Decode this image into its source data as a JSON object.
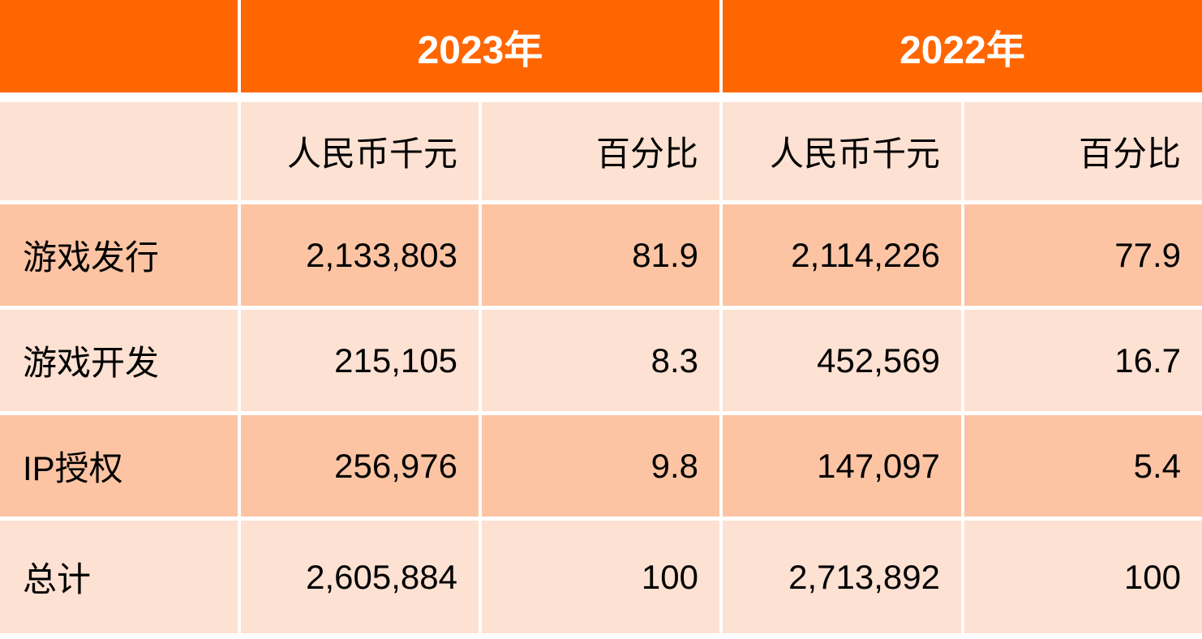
{
  "header": {
    "corner": "",
    "years": [
      "2023年",
      "2022年"
    ]
  },
  "subheader": {
    "corner": "",
    "columns": [
      "人民币千元",
      "百分比",
      "人民币千元",
      "百分比"
    ]
  },
  "rows": [
    {
      "label": "游戏发行",
      "values": [
        "2,133,803",
        "81.9",
        "2,114,226",
        "77.9"
      ],
      "shade": "dark"
    },
    {
      "label": "游戏开发",
      "values": [
        "215,105",
        "8.3",
        "452,569",
        "16.7"
      ],
      "shade": "light"
    },
    {
      "label": "IP授权",
      "values": [
        "256,976",
        "9.8",
        "147,097",
        "5.4"
      ],
      "shade": "dark"
    },
    {
      "label": "总计",
      "values": [
        "2,605,884",
        "100",
        "2,713,892",
        "100"
      ],
      "shade": "light"
    }
  ],
  "colors": {
    "header": "#FF6600",
    "light_row": "#FDE1D2",
    "dark_row": "#FCC4A3"
  }
}
